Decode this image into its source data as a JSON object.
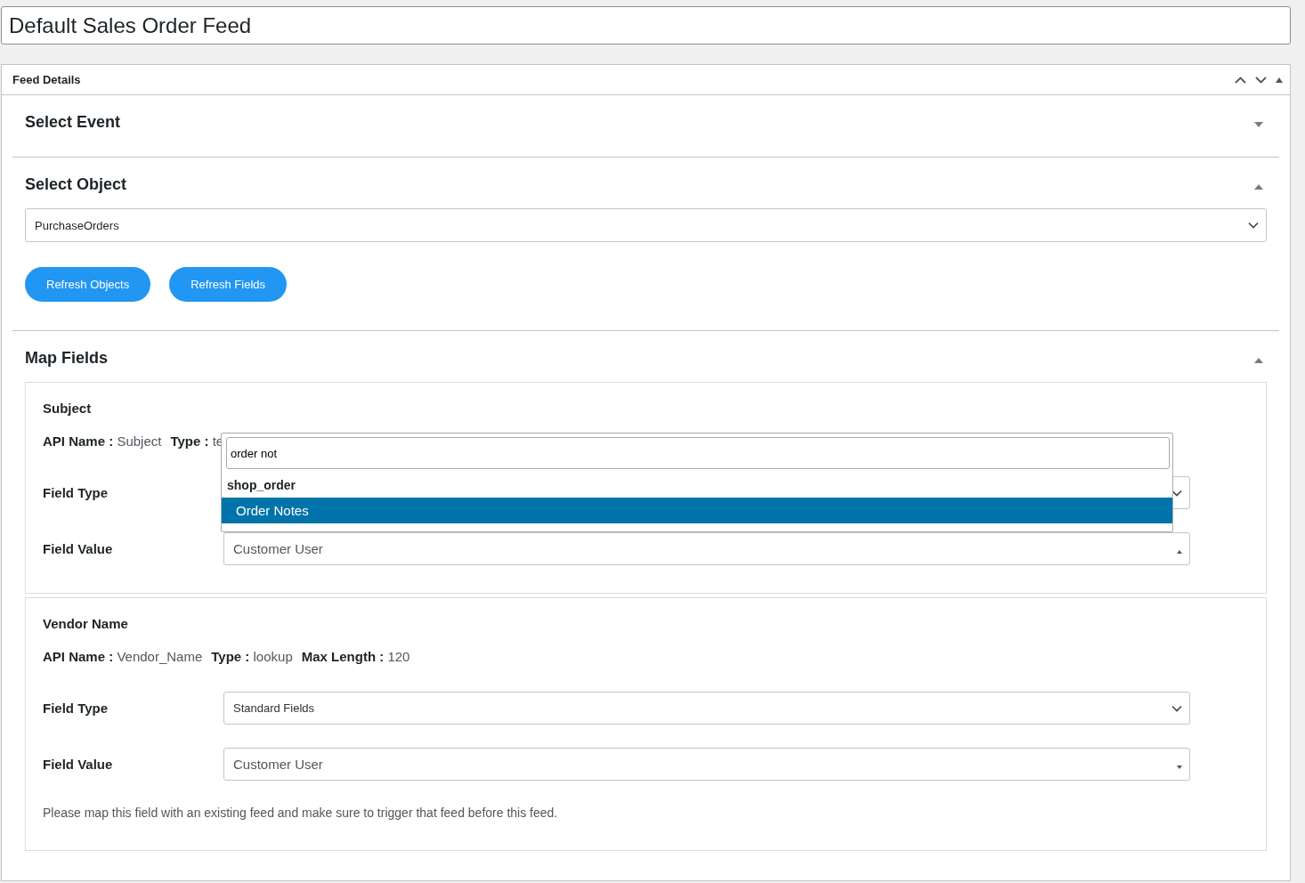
{
  "title_field": {
    "value": "Default Sales Order Feed"
  },
  "panel": {
    "title": "Feed Details"
  },
  "sections": [
    {
      "title": "Select Event",
      "expanded": false
    },
    {
      "kind": "object",
      "title": "Select Object",
      "expanded": true,
      "object_select": {
        "value": "PurchaseOrders"
      },
      "buttons": [
        "Refresh Objects",
        "Refresh Fields"
      ]
    },
    {
      "kind": "map",
      "title": "Map Fields",
      "expanded": true,
      "fields": [
        {
          "name": "Subject",
          "meta": [
            {
              "label": "API Name :",
              "value": "Subject"
            },
            {
              "label": "Type :",
              "value": "te"
            }
          ],
          "field_type": {
            "label": "Field Type"
          },
          "field_value": {
            "label": "Field Value",
            "value": "Customer User",
            "open": true
          },
          "dropdown": {
            "search": "order not",
            "group": "shop_order",
            "options": [
              {
                "label": "Order Notes",
                "selected": true
              }
            ]
          }
        },
        {
          "name": "Vendor Name",
          "meta": [
            {
              "label": "API Name :",
              "value": "Vendor_Name"
            },
            {
              "label": "Type :",
              "value": "lookup"
            },
            {
              "label": "Max Length :",
              "value": "120"
            }
          ],
          "field_type": {
            "label": "Field Type",
            "value": "Standard Fields"
          },
          "field_value": {
            "label": "Field Value",
            "value": "Customer User",
            "open": false
          },
          "note": "Please map this field with an existing feed and make sure to trigger that feed before this feed."
        }
      ]
    }
  ]
}
